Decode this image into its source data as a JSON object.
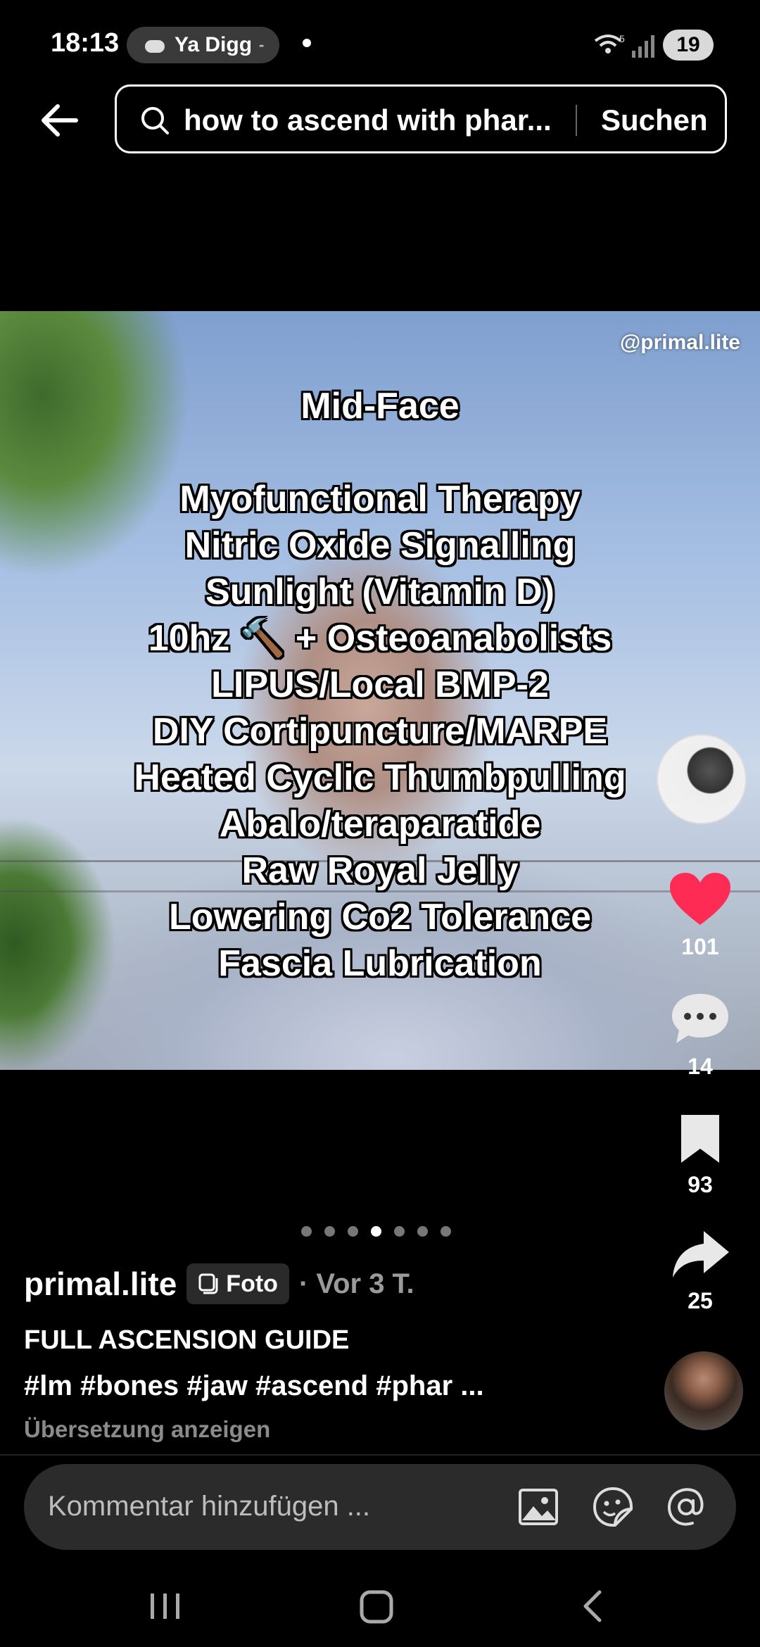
{
  "status": {
    "time": "18:13",
    "media_app": "Ya Digg",
    "battery": "19",
    "network_badge": "5"
  },
  "search": {
    "query": "how to ascend with phar...",
    "button": "Suchen"
  },
  "video": {
    "watermark": "@primal.lite",
    "heading": "Mid-Face",
    "lines": [
      "Myofunctional Therapy",
      "Nitric Oxide Signalling",
      "Sunlight (Vitamin D)",
      "10hz 🔨 + Osteoanabolists",
      "LIPUS/Local BMP-2",
      "DIY Cortipuncture/MARPE",
      "Heated Cyclic Thumbpulling",
      "Abalo/teraparatide",
      "Raw Royal Jelly",
      "Lowering Co2 Tolerance",
      "Fascia Lubrication"
    ]
  },
  "rail": {
    "likes": "101",
    "comments": "14",
    "saves": "93",
    "shares": "25"
  },
  "pager": {
    "count": 7,
    "active_index": 3
  },
  "post": {
    "author": "primal.lite",
    "badge": "Foto",
    "age": "· Vor 3 T.",
    "title": "FULL ASCENSION GUIDE",
    "hashtags": "#lm #bones #jaw #ascend #phar ...",
    "translate": "Übersetzung anzeigen"
  },
  "comment_bar": {
    "placeholder": "Kommentar hinzufügen ..."
  },
  "colors": {
    "like": "#fe2c55",
    "bg": "#000000"
  }
}
